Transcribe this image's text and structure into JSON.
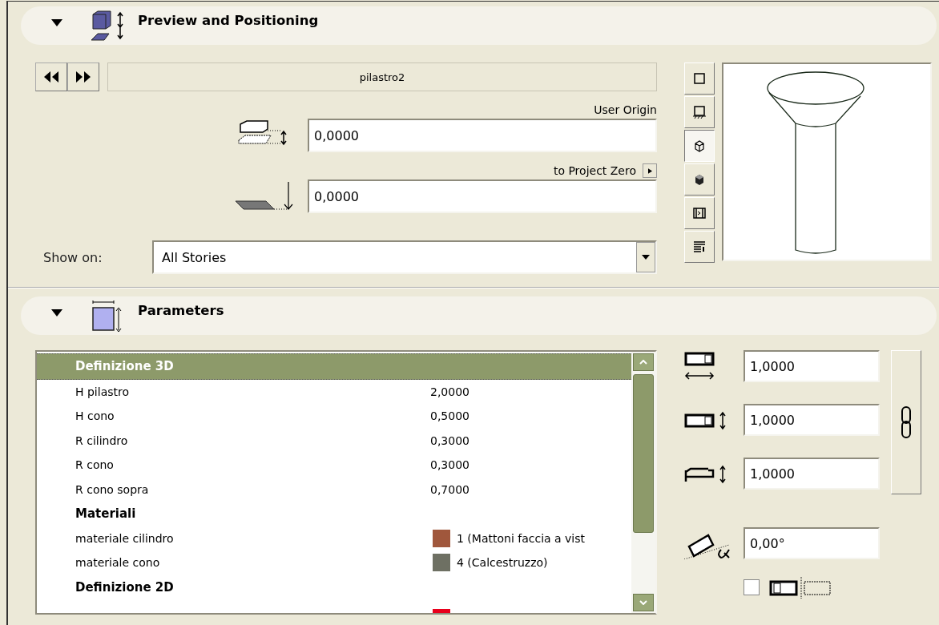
{
  "preview_section": {
    "title": "Preview and Positioning",
    "expanded": true,
    "object_name": "pilastro2",
    "user_origin_label": "User Origin",
    "elevation_value": "0,0000",
    "reference_label": "to Project Zero",
    "reference_value": "0,0000",
    "show_on_label": "Show on:",
    "show_on_value": "All Stories",
    "view_buttons": [
      {
        "selected": false
      },
      {
        "selected": false
      },
      {
        "selected": true
      },
      {
        "selected": false
      },
      {
        "selected": false
      },
      {
        "selected": false
      }
    ]
  },
  "parameters_section": {
    "title": "Parameters",
    "expanded": true,
    "rows": [
      {
        "kind": "group",
        "name": "Definizione 3D",
        "selected": true
      },
      {
        "kind": "value",
        "name": "H pilastro",
        "value": "2,0000",
        "selected": false
      },
      {
        "kind": "value",
        "name": "H cono",
        "value": "0,5000",
        "selected": false
      },
      {
        "kind": "value",
        "name": "R cilindro",
        "value": "0,3000",
        "selected": false
      },
      {
        "kind": "value",
        "name": "R cono",
        "value": "0,3000",
        "selected": false
      },
      {
        "kind": "value",
        "name": "R cono sopra",
        "value": "0,7000",
        "selected": false
      },
      {
        "kind": "group",
        "name": "Materiali",
        "selected": false
      },
      {
        "kind": "material",
        "name": "materiale cilindro",
        "value": "1 (Mattoni faccia a vist",
        "color": "#a0573c",
        "selected": false
      },
      {
        "kind": "material",
        "name": "materiale cono",
        "value": "4 (Calcestruzzo)",
        "color": "#6e7063",
        "selected": false
      },
      {
        "kind": "group",
        "name": "Definizione 2D",
        "selected": false
      },
      {
        "kind": "pen",
        "color": "#e8001c",
        "selected": false
      }
    ],
    "width_value": "1,0000",
    "depth_value": "1,0000",
    "height_value": "1,0000",
    "angle_value": "0,00°",
    "mirror_checked": false
  }
}
